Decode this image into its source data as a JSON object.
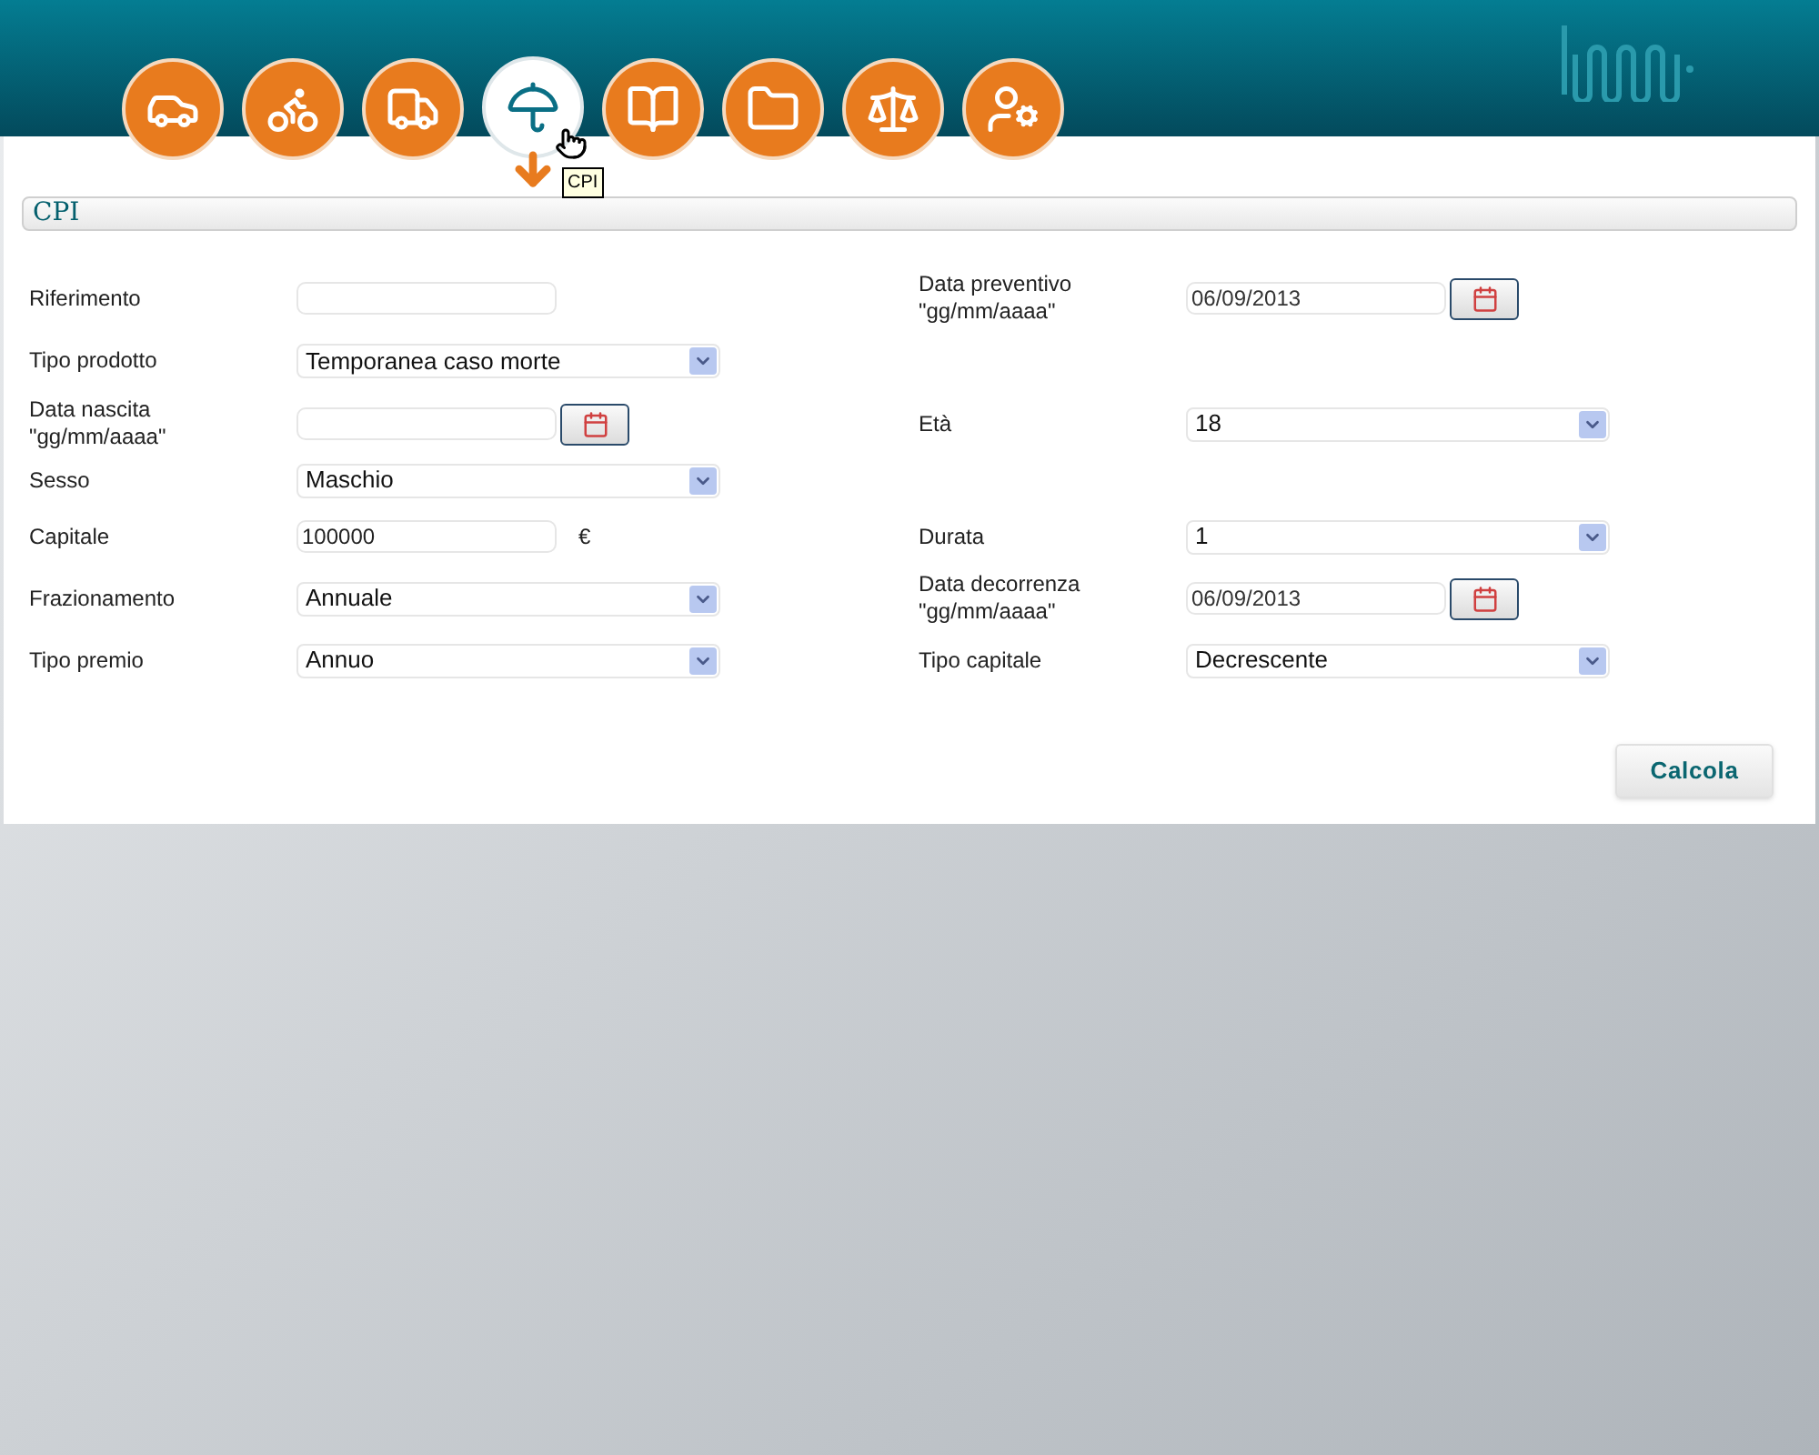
{
  "nav": {
    "items": [
      {
        "selected": false
      },
      {
        "selected": false
      },
      {
        "selected": false
      },
      {
        "selected": true
      },
      {
        "selected": false
      },
      {
        "selected": false
      },
      {
        "selected": false
      },
      {
        "selected": false
      }
    ],
    "tooltip": "CPI"
  },
  "section": {
    "title": "CPI"
  },
  "form": {
    "rows": [
      {
        "left": {
          "label": "Riferimento",
          "kind": "text"
        },
        "right": {
          "label": "Data preventivo\n\"gg/mm/aaaa\"",
          "kind": "date",
          "value": "06/09/2013"
        }
      },
      {
        "left": {
          "label": "Tipo prodotto",
          "kind": "select",
          "value": "Temporanea caso morte"
        },
        "right": null
      },
      {
        "left": {
          "label": "Data nascita\n\"gg/mm/aaaa\"",
          "kind": "date"
        },
        "right": {
          "label": "Età",
          "kind": "select",
          "value": "18"
        }
      },
      {
        "left": {
          "label": "Sesso",
          "kind": "select",
          "value": "Maschio"
        },
        "right": null
      },
      {
        "left": {
          "label": "Capitale",
          "kind": "text",
          "value": "100000",
          "suffix": "€"
        },
        "right": {
          "label": "Durata",
          "kind": "select",
          "value": "1"
        }
      },
      {
        "left": {
          "label": "Frazionamento",
          "kind": "select",
          "value": "Annuale"
        },
        "right": {
          "label": "Data decorrenza\n\"gg/mm/aaaa\"",
          "kind": "date",
          "value": "06/09/2013"
        }
      },
      {
        "left": {
          "label": "Tipo premio",
          "kind": "select",
          "value": "Annuo"
        },
        "right": {
          "label": "Tipo capitale",
          "kind": "select",
          "value": "Decrescente"
        }
      }
    ]
  },
  "buttons": {
    "calculate": "Calcola"
  }
}
